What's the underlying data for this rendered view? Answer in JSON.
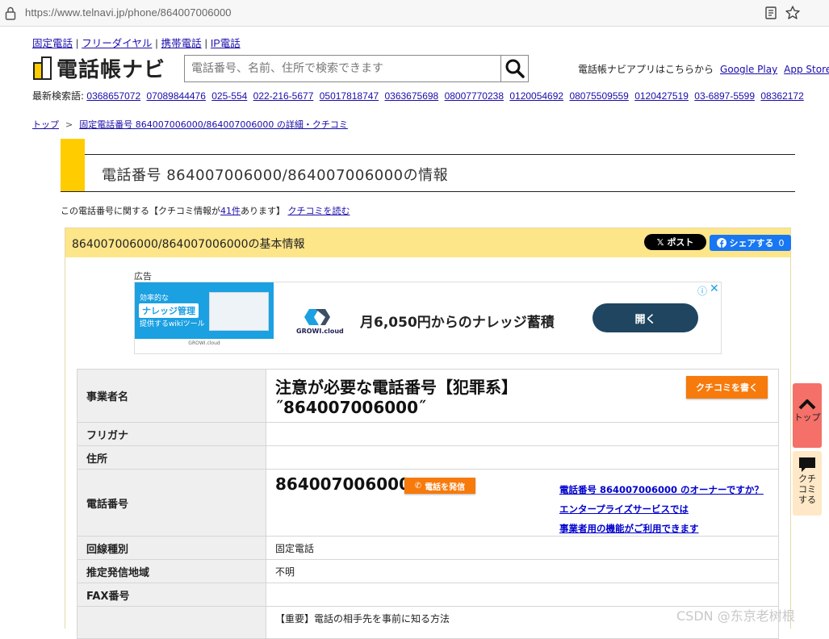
{
  "browser": {
    "url": "https://www.telnavi.jp/phone/864007006000"
  },
  "topnav": [
    {
      "label": "固定電話"
    },
    {
      "label": "フリーダイヤル"
    },
    {
      "label": "携帯電話"
    },
    {
      "label": "IP電話"
    }
  ],
  "logo": {
    "text": "電話帳ナビ"
  },
  "search": {
    "placeholder": "電話番号、名前、住所で検索できます"
  },
  "app_promo": {
    "text": "電話帳ナビアプリはこちらから",
    "google_play": "Google Play",
    "app_store": "App Store"
  },
  "recent": {
    "label": "最新検索語:",
    "items": [
      "0368657072",
      "07089844476",
      "025-554",
      "022-216-5677",
      "05017818747",
      "0363675698",
      "08007770238",
      "0120054692",
      "08075509559",
      "0120427519",
      "03-6897-5599",
      "08362172"
    ]
  },
  "breadcrumb": {
    "home": "トップ",
    "current": "固定電話番号 864007006000/864007006000 の詳細・クチコミ"
  },
  "title": "電話番号 864007006000/864007006000の情報",
  "note": {
    "prefix": "この電話番号に関する【クチコミ情報が",
    "count": "41件",
    "suffix": "あります】",
    "link": "クチコミを読む"
  },
  "panel": {
    "title": "864007006000/864007006000の基本情報",
    "x_post": "ポスト",
    "fb_share": "シェアする",
    "fb_count": "0"
  },
  "ad": {
    "label": "広告",
    "img_line1": "効率的な",
    "img_line2": "ナレッジ管理",
    "img_line3": "提供するwikiツール",
    "img_foot": "GROWI.cloud",
    "brand": "GROWI.cloud",
    "copy": "月6,050円からのナレッジ蓄積",
    "button": "開く",
    "colors": {
      "primary": "#1ba0e2",
      "button": "#1f4560"
    }
  },
  "table": {
    "business_label": "事業者名",
    "business_value_line1": "注意が必要な電話番号【犯罪系】",
    "business_value_line2": "˝864007006000˝",
    "review_button": "クチコミを書く",
    "furigana_label": "フリガナ",
    "address_label": "住所",
    "phone_label": "電話番号",
    "phone_value": "864007006000",
    "call_button": "電話を発信",
    "owner_link1": "電話番号 864007006000 のオーナーですか？",
    "owner_link2": "エンタープライズサービスでは",
    "owner_link3": "事業者用の機能がご利用できます",
    "line_label": "回線種別",
    "line_value": "固定電話",
    "region_label": "推定発信地域",
    "region_value": "不明",
    "fax_label": "FAX番号",
    "last_value": "【重要】電話の相手先を事前に知る方法"
  },
  "floating": {
    "top": "トップ",
    "kuchikomi_lines": [
      "クチ",
      "コミ",
      "する"
    ]
  },
  "watermark": "CSDN @东京老树根",
  "colors": {
    "accent_yellow": "#ffcc00",
    "panel_header": "#fde58a",
    "orange_button": "#f77a0c",
    "float_top": "#f47069"
  }
}
